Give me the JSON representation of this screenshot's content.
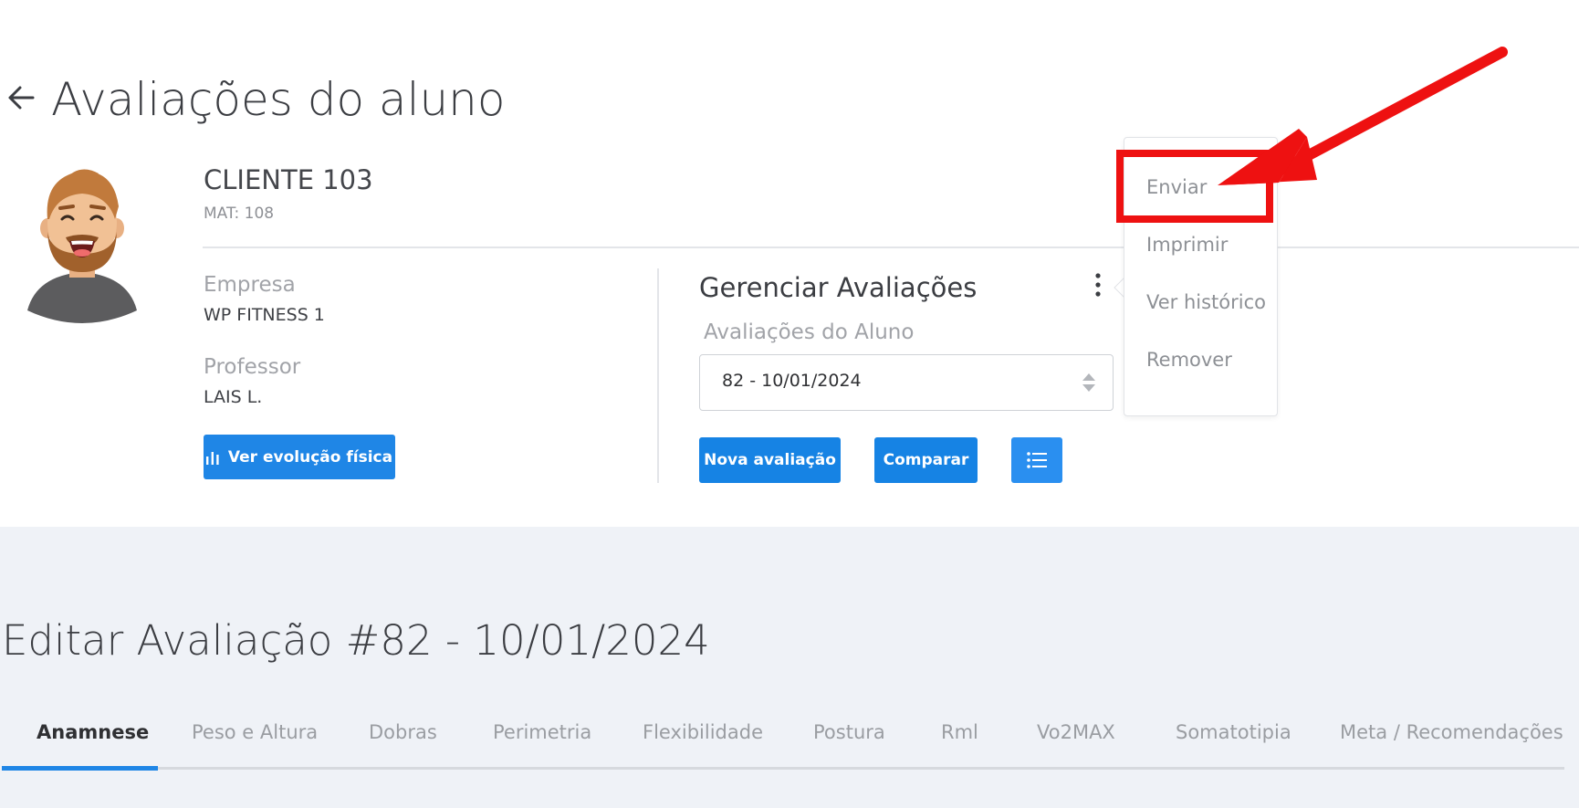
{
  "page": {
    "title": "Avaliações do aluno"
  },
  "client": {
    "name": "CLIENTE 103",
    "mat": "MAT: 108"
  },
  "info": {
    "empresa_label": "Empresa",
    "empresa_value": "WP FITNESS 1",
    "professor_label": "Professor",
    "professor_value": "LAIS L.",
    "evolucao_button": "Ver evolução física"
  },
  "manage": {
    "title": "Gerenciar Avaliações",
    "select_label": "Avaliações do Aluno",
    "selected_value": "82 - 10/01/2024",
    "nova_button": "Nova avaliação",
    "comparar_button": "Comparar"
  },
  "menu": {
    "items": [
      "Enviar",
      "Imprimir",
      "Ver histórico",
      "Remover"
    ]
  },
  "edit": {
    "title": "Editar Avaliação #82 - 10/01/2024"
  },
  "tabs": [
    {
      "label": "Anamnese",
      "active": true
    },
    {
      "label": "Peso e Altura"
    },
    {
      "label": "Dobras"
    },
    {
      "label": "Perimetria"
    },
    {
      "label": "Flexibilidade"
    },
    {
      "label": "Postura"
    },
    {
      "label": "Rml"
    },
    {
      "label": "Vo2MAX"
    },
    {
      "label": "Somatotipia"
    },
    {
      "label": "Meta / Recomendações"
    }
  ],
  "colors": {
    "primary": "#1f86e6",
    "annotation_red": "#ee1111",
    "body_background": "#eff2f7"
  },
  "icons": {
    "back": "arrow-left-icon",
    "more": "vertical-dots-icon",
    "chart": "bar-chart-icon",
    "list": "list-icon",
    "select": "updown-arrows-icon"
  }
}
